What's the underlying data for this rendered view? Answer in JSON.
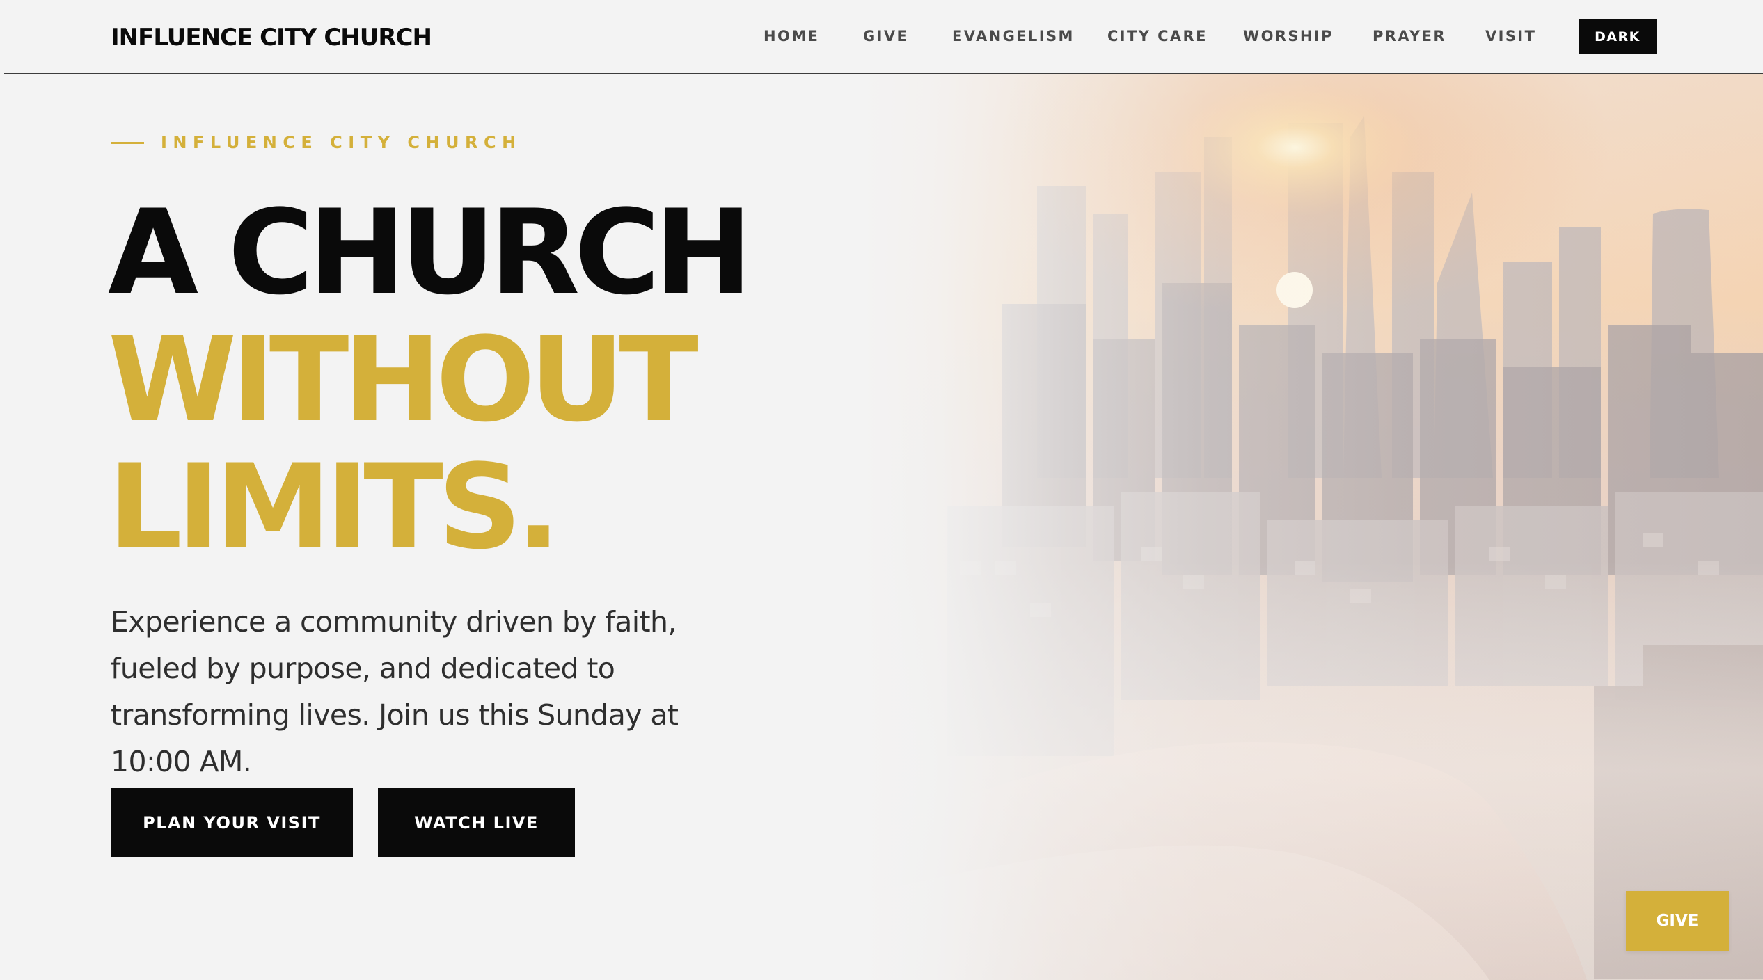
{
  "header": {
    "brand": "INFLUENCE CITY CHURCH",
    "nav": [
      {
        "id": "home",
        "label": "HOME"
      },
      {
        "id": "give",
        "label": "GIVE"
      },
      {
        "id": "evangelism",
        "label": "EVANGELISM"
      },
      {
        "id": "city-care",
        "label": "CITY CARE"
      },
      {
        "id": "worship",
        "label": "WORSHIP"
      },
      {
        "id": "prayer",
        "label": "PRAYER"
      },
      {
        "id": "visit",
        "label": "VISIT"
      }
    ],
    "theme_toggle_label": "DARK"
  },
  "hero": {
    "eyebrow": "INFLUENCE CITY CHURCH",
    "headline": {
      "line1": "A CHURCH",
      "line2": "WITHOUT",
      "line3": "LIMITS."
    },
    "intro": "Experience a community driven by faith, fueled by purpose, and dedicated to transforming lives. Join us this Sunday at 10:00 AM.",
    "primary_cta": "PLAN YOUR VISIT",
    "secondary_cta": "WATCH LIVE"
  },
  "floating_give_label": "GIVE",
  "colors": {
    "background": "#f3f3f3",
    "accent_gold": "#d4b03a",
    "text_dark": "#0a0a0a",
    "button_dark": "#0a0a0a"
  }
}
